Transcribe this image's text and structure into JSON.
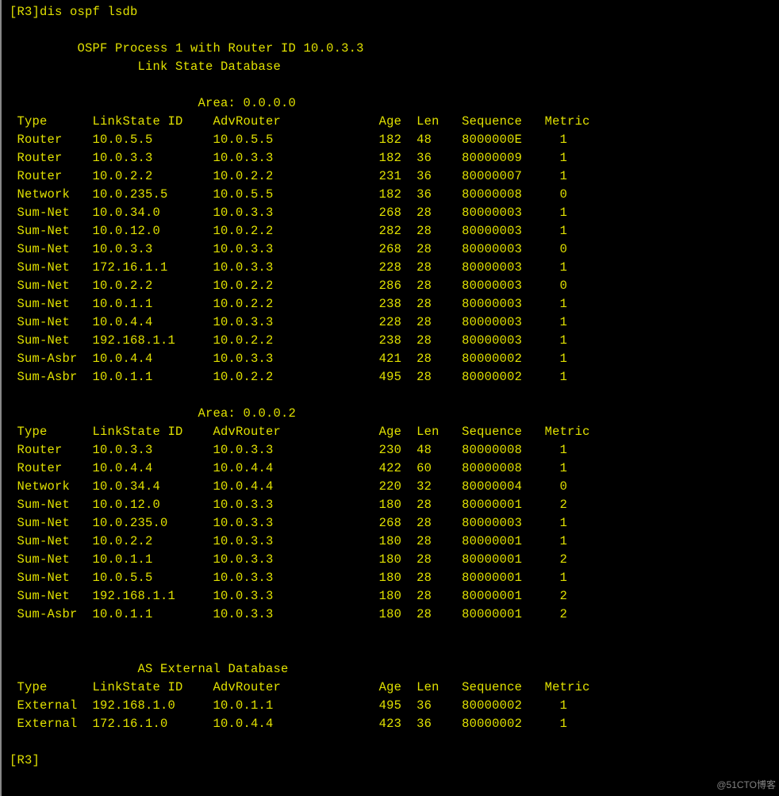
{
  "prompt_open": "[R3]",
  "command": "dis ospf lsdb",
  "process_line": "OSPF Process 1 with Router ID 10.0.3.3",
  "lsdb_title": "Link State Database",
  "area0_label": "Area: 0.0.0.0",
  "area2_label": "Area: 0.0.0.2",
  "ext_db_label": "AS External Database",
  "headers": {
    "type": "Type",
    "lsid": "LinkState ID",
    "adv": "AdvRouter",
    "age": "Age",
    "len": "Len",
    "seq": "Sequence",
    "metric": "Metric"
  },
  "area0_rows": [
    {
      "type": "Router",
      "lsid": "10.0.5.5",
      "adv": "10.0.5.5",
      "age": "182",
      "len": "48",
      "seq": "8000000E",
      "metric": "1"
    },
    {
      "type": "Router",
      "lsid": "10.0.3.3",
      "adv": "10.0.3.3",
      "age": "182",
      "len": "36",
      "seq": "80000009",
      "metric": "1"
    },
    {
      "type": "Router",
      "lsid": "10.0.2.2",
      "adv": "10.0.2.2",
      "age": "231",
      "len": "36",
      "seq": "80000007",
      "metric": "1"
    },
    {
      "type": "Network",
      "lsid": "10.0.235.5",
      "adv": "10.0.5.5",
      "age": "182",
      "len": "36",
      "seq": "80000008",
      "metric": "0"
    },
    {
      "type": "Sum-Net",
      "lsid": "10.0.34.0",
      "adv": "10.0.3.3",
      "age": "268",
      "len": "28",
      "seq": "80000003",
      "metric": "1"
    },
    {
      "type": "Sum-Net",
      "lsid": "10.0.12.0",
      "adv": "10.0.2.2",
      "age": "282",
      "len": "28",
      "seq": "80000003",
      "metric": "1"
    },
    {
      "type": "Sum-Net",
      "lsid": "10.0.3.3",
      "adv": "10.0.3.3",
      "age": "268",
      "len": "28",
      "seq": "80000003",
      "metric": "0"
    },
    {
      "type": "Sum-Net",
      "lsid": "172.16.1.1",
      "adv": "10.0.3.3",
      "age": "228",
      "len": "28",
      "seq": "80000003",
      "metric": "1"
    },
    {
      "type": "Sum-Net",
      "lsid": "10.0.2.2",
      "adv": "10.0.2.2",
      "age": "286",
      "len": "28",
      "seq": "80000003",
      "metric": "0"
    },
    {
      "type": "Sum-Net",
      "lsid": "10.0.1.1",
      "adv": "10.0.2.2",
      "age": "238",
      "len": "28",
      "seq": "80000003",
      "metric": "1"
    },
    {
      "type": "Sum-Net",
      "lsid": "10.0.4.4",
      "adv": "10.0.3.3",
      "age": "228",
      "len": "28",
      "seq": "80000003",
      "metric": "1"
    },
    {
      "type": "Sum-Net",
      "lsid": "192.168.1.1",
      "adv": "10.0.2.2",
      "age": "238",
      "len": "28",
      "seq": "80000003",
      "metric": "1"
    },
    {
      "type": "Sum-Asbr",
      "lsid": "10.0.4.4",
      "adv": "10.0.3.3",
      "age": "421",
      "len": "28",
      "seq": "80000002",
      "metric": "1"
    },
    {
      "type": "Sum-Asbr",
      "lsid": "10.0.1.1",
      "adv": "10.0.2.2",
      "age": "495",
      "len": "28",
      "seq": "80000002",
      "metric": "1"
    }
  ],
  "area2_rows": [
    {
      "type": "Router",
      "lsid": "10.0.3.3",
      "adv": "10.0.3.3",
      "age": "230",
      "len": "48",
      "seq": "80000008",
      "metric": "1"
    },
    {
      "type": "Router",
      "lsid": "10.0.4.4",
      "adv": "10.0.4.4",
      "age": "422",
      "len": "60",
      "seq": "80000008",
      "metric": "1"
    },
    {
      "type": "Network",
      "lsid": "10.0.34.4",
      "adv": "10.0.4.4",
      "age": "220",
      "len": "32",
      "seq": "80000004",
      "metric": "0"
    },
    {
      "type": "Sum-Net",
      "lsid": "10.0.12.0",
      "adv": "10.0.3.3",
      "age": "180",
      "len": "28",
      "seq": "80000001",
      "metric": "2"
    },
    {
      "type": "Sum-Net",
      "lsid": "10.0.235.0",
      "adv": "10.0.3.3",
      "age": "268",
      "len": "28",
      "seq": "80000003",
      "metric": "1"
    },
    {
      "type": "Sum-Net",
      "lsid": "10.0.2.2",
      "adv": "10.0.3.3",
      "age": "180",
      "len": "28",
      "seq": "80000001",
      "metric": "1"
    },
    {
      "type": "Sum-Net",
      "lsid": "10.0.1.1",
      "adv": "10.0.3.3",
      "age": "180",
      "len": "28",
      "seq": "80000001",
      "metric": "2"
    },
    {
      "type": "Sum-Net",
      "lsid": "10.0.5.5",
      "adv": "10.0.3.3",
      "age": "180",
      "len": "28",
      "seq": "80000001",
      "metric": "1"
    },
    {
      "type": "Sum-Net",
      "lsid": "192.168.1.1",
      "adv": "10.0.3.3",
      "age": "180",
      "len": "28",
      "seq": "80000001",
      "metric": "2"
    },
    {
      "type": "Sum-Asbr",
      "lsid": "10.0.1.1",
      "adv": "10.0.3.3",
      "age": "180",
      "len": "28",
      "seq": "80000001",
      "metric": "2"
    }
  ],
  "ext_rows": [
    {
      "type": "External",
      "lsid": "192.168.1.0",
      "adv": "10.0.1.1",
      "age": "495",
      "len": "36",
      "seq": "80000002",
      "metric": "1"
    },
    {
      "type": "External",
      "lsid": "172.16.1.0",
      "adv": "10.0.4.4",
      "age": "423",
      "len": "36",
      "seq": "80000002",
      "metric": "1"
    }
  ],
  "prompt_close": "[R3]",
  "watermark": "@51CTO博客"
}
